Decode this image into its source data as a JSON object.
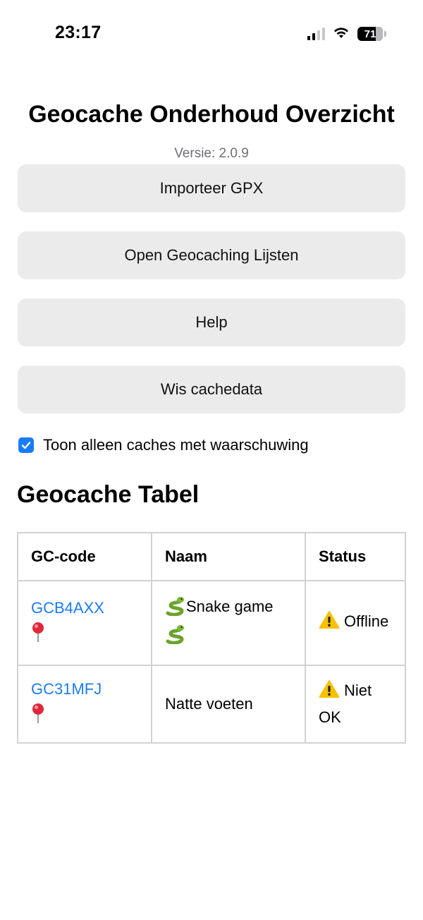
{
  "statusbar": {
    "time": "23:17",
    "battery": "71"
  },
  "header": {
    "title": "Geocache Onderhoud Overzicht",
    "version": "Versie: 2.0.9"
  },
  "buttons": {
    "import": "Importeer GPX",
    "open_lists": "Open Geocaching Lijsten",
    "help": "Help",
    "clear": "Wis cachedata"
  },
  "filter": {
    "label": "Toon alleen caches met waarschuwing",
    "checked": true
  },
  "table": {
    "title": "Geocache Tabel",
    "headers": [
      "GC-code",
      "Naam",
      "Status"
    ],
    "rows": [
      {
        "code": "GCB4AXX",
        "name": "Snake game",
        "status": "Offline"
      },
      {
        "code": "GC31MFJ",
        "name": "Natte voeten",
        "status": "Niet OK"
      }
    ]
  },
  "icons": {
    "map_pin": "map-pin-icon",
    "warning": "warning-icon",
    "snake": "snake-icon",
    "checkbox": "checkmark-icon"
  },
  "colors": {
    "link": "#1a7cf5",
    "checkbox": "#1a7cf5",
    "button_bg": "#ebebeb",
    "version_text": "#6e6e73"
  }
}
